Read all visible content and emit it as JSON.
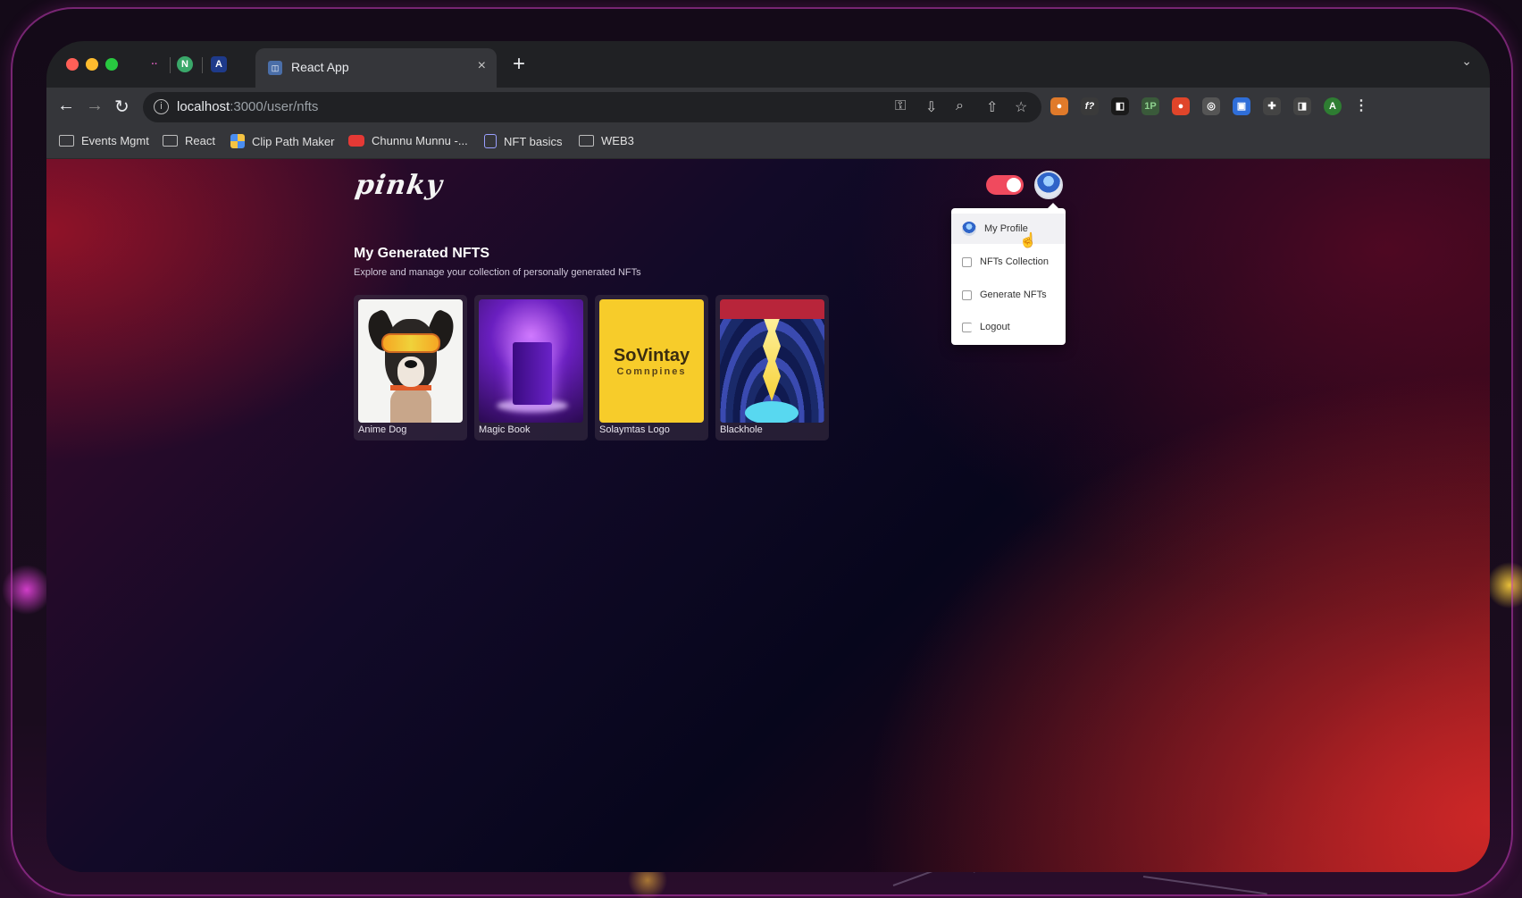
{
  "browser": {
    "tabs": {
      "tiny1": "··",
      "tiny2": "N",
      "tiny3": "A",
      "active_title": "React App",
      "close": "×",
      "new_tab": "+",
      "chevron": "⌄"
    },
    "nav": {
      "back": "←",
      "forward": "→",
      "reload": "↻"
    },
    "url": {
      "host": "localhost",
      "path": ":3000/user/nfts"
    },
    "omni_icons": {
      "key": "⚿",
      "install": "⇩",
      "zoom": "⌕",
      "share": "⇧",
      "star": "☆"
    },
    "extensions": [
      {
        "glyph": "●",
        "color": "#e07a2a"
      },
      {
        "glyph": "f?",
        "color": "#3a3a3a"
      },
      {
        "glyph": "◧",
        "color": "#1a1a1a"
      },
      {
        "glyph": "1P",
        "color": "#3a5a3a"
      },
      {
        "glyph": "●",
        "color": "#e0452a"
      },
      {
        "glyph": "◎",
        "color": "#555"
      },
      {
        "glyph": "▣",
        "color": "#2f6ed8"
      },
      {
        "glyph": "✚",
        "color": "#444"
      },
      {
        "glyph": "◨",
        "color": "#444"
      },
      {
        "glyph": "A",
        "color": "#2e7d32"
      },
      {
        "glyph": "⋮",
        "color": "#35363a"
      }
    ],
    "bookmarks": [
      "Events Mgmt",
      "React",
      "Clip Path Maker",
      "Chunnu Munnu -...",
      "NFT basics",
      "WEB3"
    ]
  },
  "app": {
    "logo": "pinky",
    "menu": {
      "my_profile": "My Profile",
      "nfts_collection": "NFTs Collection",
      "generate_nfts": "Generate NFTs",
      "logout": "Logout"
    },
    "section": {
      "title": "My Generated NFTS",
      "subtitle": "Explore and manage your collection of personally generated NFTs"
    },
    "nfts": [
      {
        "name": "Anime Dog"
      },
      {
        "name": "Magic Book"
      },
      {
        "name": "Solaymtas Logo",
        "art_text": "SoVintay",
        "art_sub": "Comnpines"
      },
      {
        "name": "Blackhole"
      }
    ],
    "colors": {
      "toggle": "#f04a5e",
      "accent_red": "#d22a2a"
    }
  }
}
